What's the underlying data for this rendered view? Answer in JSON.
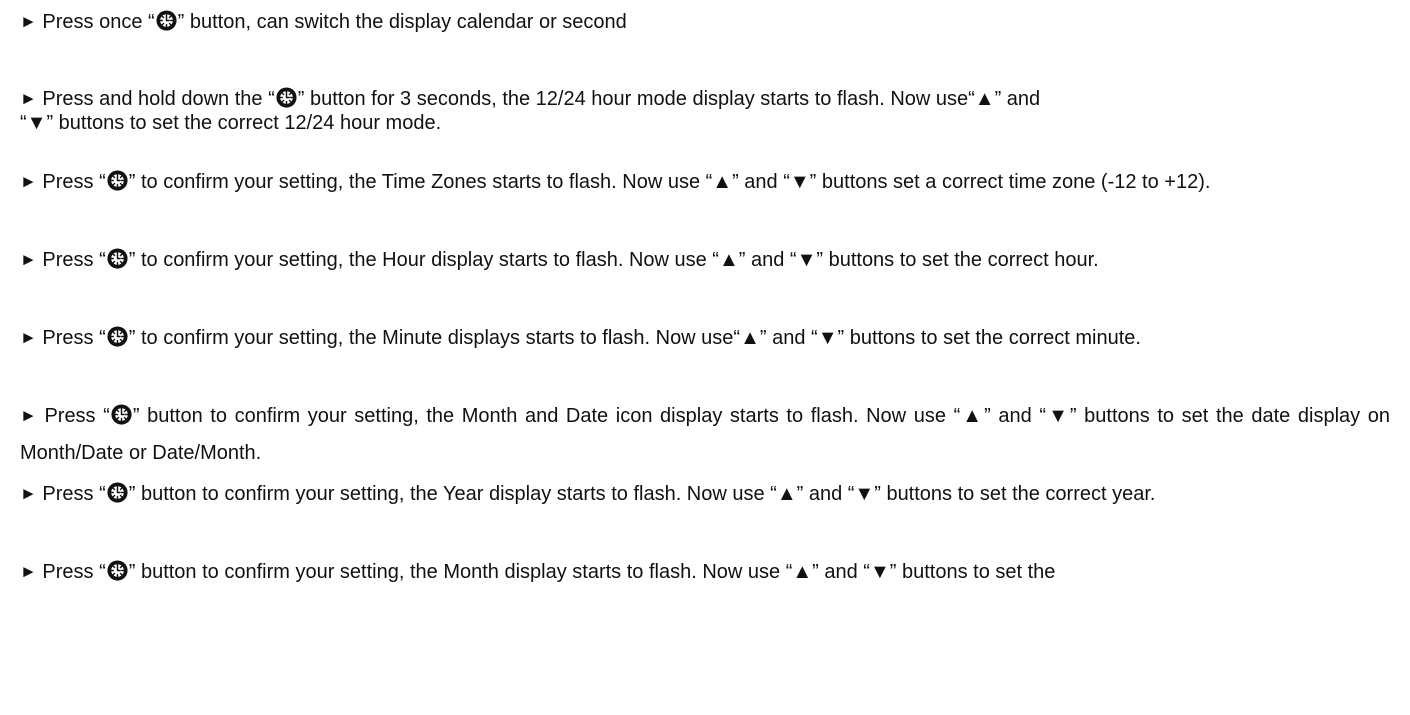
{
  "bullet": "►",
  "icon_name": "clock-button-icon",
  "items": [
    {
      "a": "Press once “",
      "b": "” button, can switch the display calendar or second"
    },
    {
      "a": "Press and hold down the “",
      "b": "” button for 3 seconds, the 12/24 hour mode display starts to flash. Now use“▲” and",
      "c": "“▼” buttons to set the correct 12/24 hour mode."
    },
    {
      "a": "Press “",
      "b": "” to confirm your setting, the Time Zones starts to flash. Now use “▲” and “▼” buttons set a correct time zone (-12 to +12)."
    },
    {
      "a": "Press “",
      "b": "” to confirm your setting, the Hour display starts to flash. Now use “▲” and “▼” buttons to set the correct hour."
    },
    {
      "a": "Press “",
      "b": "” to confirm your setting, the Minute displays starts to flash. Now use“▲” and “▼” buttons to set the correct minute."
    },
    {
      "a": "Press “",
      "b": "” button to confirm your setting, the Month and Date icon display starts to flash. Now use “▲” and “▼” buttons to set the date display on Month/Date or Date/Month."
    },
    {
      "a": "Press “",
      "b": "” button to confirm your setting, the Year display starts to flash. Now use “▲” and “▼” buttons to set the correct year."
    },
    {
      "a": "Press “",
      "b": "” button to confirm your setting, the Month display starts to flash. Now use “▲” and “▼” buttons to set the"
    }
  ]
}
